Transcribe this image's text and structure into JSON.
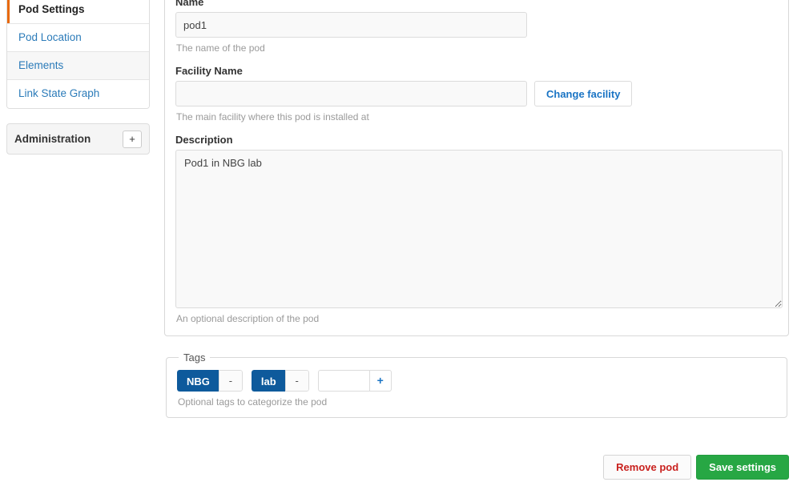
{
  "sidebar": {
    "nav_items": [
      {
        "label": "Pod Settings",
        "state": "active"
      },
      {
        "label": "Pod Location",
        "state": "default"
      },
      {
        "label": "Elements",
        "state": "striped"
      },
      {
        "label": "Link State Graph",
        "state": "default"
      }
    ],
    "administration": {
      "title": "Administration",
      "expand_label": "+"
    }
  },
  "form": {
    "name": {
      "label": "Name",
      "value": "pod1",
      "placeholder": "",
      "help": "The name of the pod"
    },
    "facility": {
      "label": "Facility Name",
      "value": "",
      "placeholder": "",
      "help": "The main facility where this pod is installed at",
      "change_button": "Change facility"
    },
    "description": {
      "label": "Description",
      "value": "Pod1 in NBG lab",
      "placeholder": "",
      "help": "An optional description of the pod"
    }
  },
  "tags": {
    "legend": "Tags",
    "items": [
      {
        "label": "NBG",
        "remove_label": "-"
      },
      {
        "label": "lab",
        "remove_label": "-"
      }
    ],
    "new_tag_value": "",
    "new_tag_placeholder": "",
    "add_label": "+",
    "help": "Optional tags to categorize the pod"
  },
  "footer": {
    "remove_label": "Remove pod",
    "save_label": "Save settings"
  },
  "colors": {
    "accent_orange": "#e8690b",
    "link_blue": "#2b7bb9",
    "tag_blue": "#0e5a9c",
    "save_green": "#27a744",
    "danger_red": "#c9211e"
  }
}
